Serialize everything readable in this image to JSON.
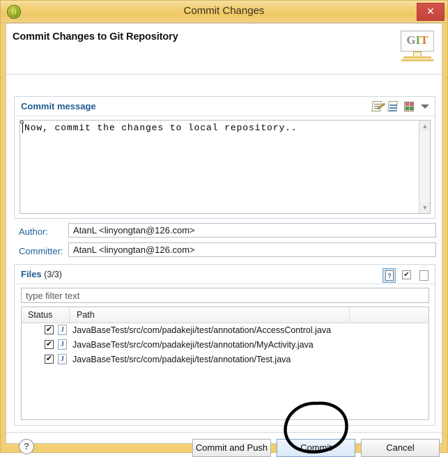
{
  "window": {
    "title": "Commit Changes",
    "icon": "git-circle-icon",
    "close_label": "✕"
  },
  "header": {
    "heading": "Commit Changes to Git Repository",
    "logo": {
      "g": "G",
      "i": "I",
      "t": "T",
      "name": "git-logo"
    }
  },
  "commit_message": {
    "group_title": "Commit message",
    "text": "Now, commit the changes to local repository..",
    "toolbar": [
      {
        "name": "amend-commit-icon",
        "tooltip": "Amend"
      },
      {
        "name": "signed-off-icon",
        "tooltip": "Add Signed-off-by"
      },
      {
        "name": "change-id-icon",
        "tooltip": "Add Change-Id"
      },
      {
        "name": "chevron-down-icon",
        "tooltip": "More"
      }
    ],
    "scroll_up": "▲",
    "scroll_down": "▼"
  },
  "author": {
    "label": "Author:",
    "value": "AtanL <linyongtan@126.com>"
  },
  "committer": {
    "label": "Committer:",
    "value": "AtanL <linyongtan@126.com>"
  },
  "files": {
    "group_title": "Files",
    "count_label": "(3/3)",
    "toolbar": [
      {
        "name": "show-untracked-icon",
        "glyph": "?",
        "pressed": true
      },
      {
        "name": "select-all-icon",
        "glyph": "✔",
        "pressed": false
      },
      {
        "name": "deselect-all-icon",
        "glyph": "",
        "pressed": false
      }
    ],
    "filter_placeholder": "type filter text",
    "filter_value": "",
    "columns": [
      "Status",
      "Path"
    ],
    "rows": [
      {
        "checked": true,
        "check_glyph": "✔",
        "file_icon": "java-file-icon",
        "file_icon_glyph": "J",
        "path": "JavaBaseTest/src/com/padakeji/test/annotation/AccessControl.java"
      },
      {
        "checked": true,
        "check_glyph": "✔",
        "file_icon": "java-file-icon",
        "file_icon_glyph": "J",
        "path": "JavaBaseTest/src/com/padakeji/test/annotation/MyActivity.java"
      },
      {
        "checked": true,
        "check_glyph": "✔",
        "file_icon": "java-file-icon",
        "file_icon_glyph": "J",
        "path": "JavaBaseTest/src/com/padakeji/test/annotation/Test.java"
      }
    ]
  },
  "footer": {
    "help_glyph": "?",
    "commit_and_push": "Commit and Push",
    "commit": "Commit",
    "cancel": "Cancel"
  },
  "annotation": {
    "name": "hand-drawn-circle",
    "target": "Commit",
    "color": "#000000"
  },
  "colors": {
    "titlebar": "#f0cd6e",
    "frame": "#f2cf73",
    "close": "#c7453e",
    "group_title": "#1f5b8f",
    "field_label": "#1d5f99",
    "focus_button": "#d9e8f7"
  }
}
